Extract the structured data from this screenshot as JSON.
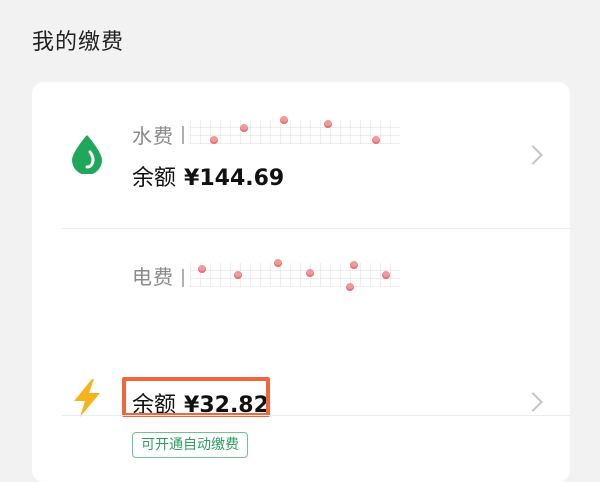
{
  "section": {
    "title": "我的缴费"
  },
  "bills": {
    "water": {
      "name": "水费",
      "balance_label": "余额",
      "balance_amount": "¥144.69",
      "icon": "water-drop-icon",
      "icon_color": "#1fa85a"
    },
    "electricity": {
      "name": "电费",
      "balance_label": "余额",
      "balance_amount": "¥32.82",
      "icon": "lightning-icon",
      "icon_color": "#f6b41c",
      "auto_pay_label": "可开通自动缴费"
    }
  },
  "colors": {
    "highlight": "#f0673a",
    "accent_green": "#2e9e62"
  }
}
